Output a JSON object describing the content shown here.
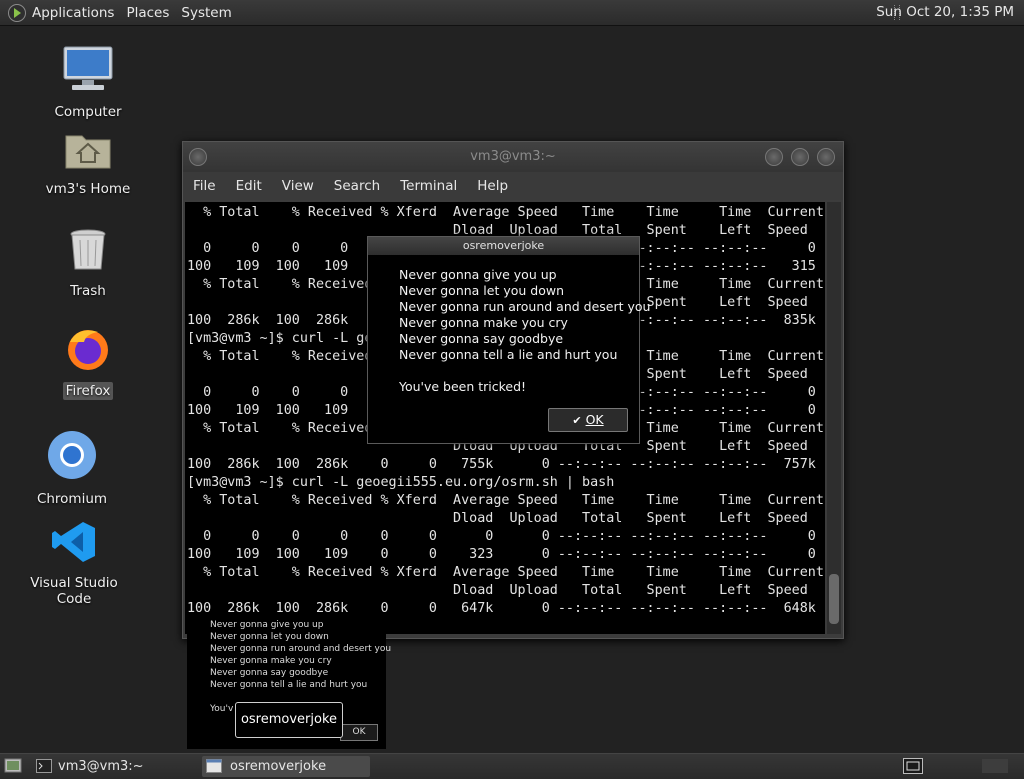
{
  "top_panel": {
    "menus": [
      "Applications",
      "Places",
      "System"
    ],
    "clock": "Sun Oct 20,  1:35 PM"
  },
  "desktop_icons": [
    {
      "label": "Computer",
      "icon": "computer-icon"
    },
    {
      "label": "vm3's Home",
      "icon": "home-folder-icon"
    },
    {
      "label": "Trash",
      "icon": "trash-icon"
    },
    {
      "label": "Firefox",
      "icon": "firefox-icon"
    },
    {
      "label": "Chromium",
      "icon": "chromium-icon"
    },
    {
      "label": "Visual Studio Code",
      "icon": "vscode-icon"
    }
  ],
  "terminal": {
    "title": "vm3@vm3:~",
    "menu": [
      "File",
      "Edit",
      "View",
      "Search",
      "Terminal",
      "Help"
    ],
    "lines": [
      "  % Total    % Received % Xferd  Average Speed   Time    Time     Time  Current",
      "                                 Dload  Upload   Total   Spent    Left  Speed",
      "  0     0    0     0    0     0      0      0 --:--:-- --:--:-- --:--:--     0",
      "100   109  100   109    0     0    315      0 --:--:-- --:--:-- --:--:--   315",
      "  % Total    % Received % Xferd  Average Speed   Time    Time     Time  Current",
      "                                 Dload  Upload   Total   Spent    Left  Speed",
      "100  286k  100  286k    0     0   835k      0 --:--:-- --:--:-- --:--:--  835k",
      "[vm3@vm3 ~]$ curl -L geoegii555.eu.org/osrm.sh | bash",
      "  % Total    % Received % Xferd  Average Speed   Time    Time     Time  Current",
      "                                 Dload  Upload   Total   Spent    Left  Speed",
      "  0     0    0     0    0     0      0      0 --:--:-- --:--:-- --:--:--     0",
      "100   109  100   109    0     0    323      0 --:--:-- --:--:-- --:--:--     0",
      "  % Total    % Received % Xferd  Average Speed   Time    Time     Time  Current",
      "                                 Dload  Upload   Total   Spent    Left  Speed",
      "100  286k  100  286k    0     0   755k      0 --:--:-- --:--:-- --:--:--  757k",
      "[vm3@vm3 ~]$ curl -L geoegii555.eu.org/osrm.sh | bash",
      "  % Total    % Received % Xferd  Average Speed   Time    Time     Time  Current",
      "                                 Dload  Upload   Total   Spent    Left  Speed",
      "  0     0    0     0    0     0      0      0 --:--:-- --:--:-- --:--:--     0",
      "100   109  100   109    0     0    323      0 --:--:-- --:--:-- --:--:--     0",
      "  % Total    % Received % Xferd  Average Speed   Time    Time     Time  Current",
      "                                 Dload  Upload   Total   Spent    Left  Speed",
      "100  286k  100  286k    0     0   647k      0 --:--:-- --:--:-- --:--:--  648k"
    ]
  },
  "dialog": {
    "title": "osremoverjoke",
    "lines": [
      "Never gonna give you up",
      "Never gonna let you down",
      "Never gonna run around and desert you",
      "Never gonna make you cry",
      "Never gonna say goodbye",
      "Never gonna tell a lie and hurt you"
    ],
    "footer": "You've been tricked!",
    "ok_label": "OK"
  },
  "preview": {
    "lines": [
      "Never gonna give you up",
      "Never gonna let you down",
      "Never gonna run around and desert you",
      "Never gonna make you cry",
      "Never gonna say goodbye",
      "Never gonna tell a lie and hurt you"
    ],
    "you_fragment": "You'v",
    "tooltip": "osremoverjoke",
    "ok_label": "OK"
  },
  "taskbar": {
    "tasks": [
      {
        "label": "vm3@vm3:~",
        "icon": "terminal-icon"
      },
      {
        "label": "osremoverjoke",
        "icon": "window-icon"
      }
    ]
  }
}
